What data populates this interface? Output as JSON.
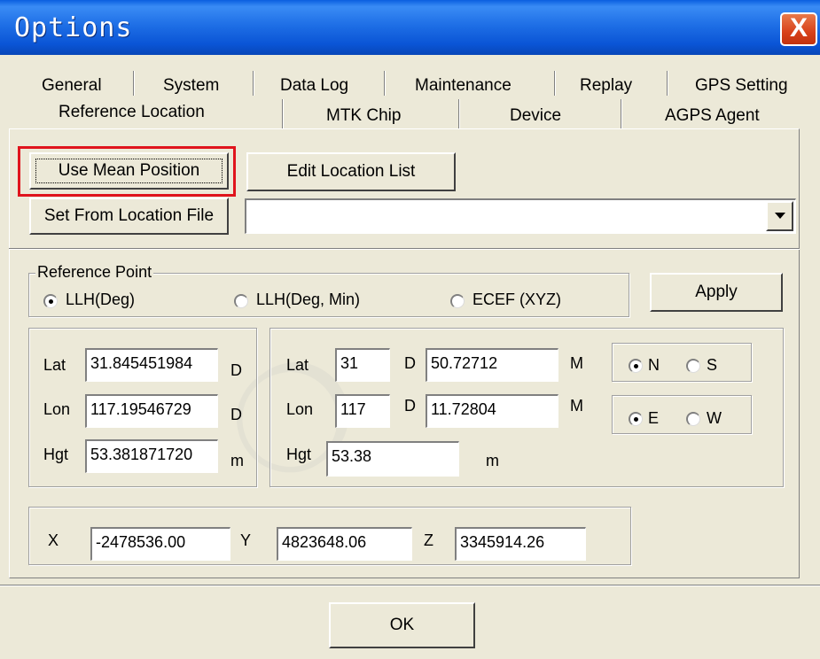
{
  "window": {
    "title": "Options",
    "close_label": "X"
  },
  "tabs": {
    "row1": [
      "General",
      "System",
      "Data Log",
      "Maintenance",
      "Replay",
      "GPS Setting"
    ],
    "row2": [
      "Reference Location",
      "MTK Chip",
      "Device",
      "AGPS Agent"
    ],
    "active": "Reference Location"
  },
  "actions": {
    "use_mean_position": "Use Mean Position",
    "edit_location_list": "Edit Location List",
    "set_from_location_file": "Set From Location File",
    "location_file_value": "",
    "apply": "Apply",
    "ok": "OK"
  },
  "reference_point": {
    "label": "Reference Point",
    "options": [
      "LLH(Deg)",
      "LLH(Deg, Min)",
      "ECEF (XYZ)"
    ],
    "selected": "LLH(Deg)"
  },
  "llh_deg": {
    "lat_label": "Lat",
    "lat_value": "31.845451984",
    "lat_unit": "D",
    "lon_label": "Lon",
    "lon_value": "117.19546729",
    "lon_unit": "D",
    "hgt_label": "Hgt",
    "hgt_value": "53.381871720",
    "hgt_unit": "m"
  },
  "llh_degmin": {
    "lat_label": "Lat",
    "lat_deg": "31",
    "lat_d": "D",
    "lat_min": "50.72712",
    "lat_m": "M",
    "lon_label": "Lon",
    "lon_deg": "117",
    "lon_d": "D",
    "lon_min": "11.72804",
    "lon_m": "M",
    "hgt_label": "Hgt",
    "hgt_value": "53.38",
    "hgt_unit": "m",
    "ns": {
      "n": "N",
      "s": "S",
      "selected": "N"
    },
    "ew": {
      "e": "E",
      "w": "W",
      "selected": "E"
    }
  },
  "ecef": {
    "x_label": "X",
    "x_value": "-2478536.00",
    "y_label": "Y",
    "y_value": "4823648.06",
    "z_label": "Z",
    "z_value": "3345914.26"
  },
  "colors": {
    "titlebar": "#0a55d6",
    "highlight": "#e0141d",
    "face": "#ece9d8"
  }
}
